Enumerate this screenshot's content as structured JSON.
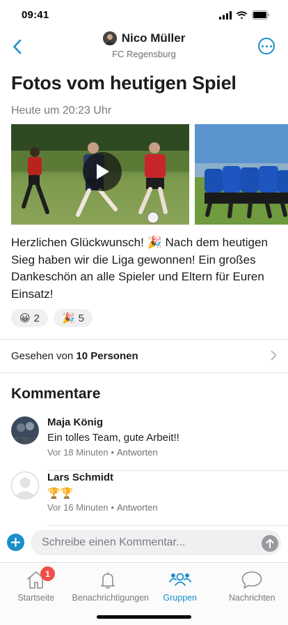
{
  "status_bar": {
    "time": "09:41"
  },
  "header": {
    "name": "Nico Müller",
    "subtitle": "FC Regensburg"
  },
  "post": {
    "title": "Fotos vom heutigen Spiel",
    "timestamp": "Heute um 20:23 Uhr",
    "body": "Herzlichen Glückwunsch! 🎉 Nach dem heutigen Sieg haben wir die Liga gewonnen! Ein großes Dankeschön an alle Spieler und Eltern für Euren Einsatz!",
    "reactions": [
      {
        "emoji": "😀",
        "count": "2"
      },
      {
        "emoji": "🎉",
        "count": "5"
      }
    ]
  },
  "seen": {
    "prefix": "Gesehen von",
    "count": "10 Personen"
  },
  "comments": {
    "title": "Kommentare",
    "items": [
      {
        "name": "Maja König",
        "text": "Ein tolles Team, gute Arbeit!!",
        "time": "Vor 18 Minuten",
        "reply": "Antworten"
      },
      {
        "name": "Lars Schmidt",
        "text": "🏆🏆",
        "time": "Vor 16 Minuten",
        "reply": "Antworten"
      }
    ]
  },
  "composer": {
    "placeholder": "Schreibe einen Kommentar..."
  },
  "tabbar": {
    "items": [
      {
        "label": "Startseite",
        "icon": "home-icon",
        "badge": "1"
      },
      {
        "label": "Benachrichtigungen",
        "icon": "bell-icon"
      },
      {
        "label": "Gruppen",
        "icon": "groups-icon",
        "active": true
      },
      {
        "label": "Nachrichten",
        "icon": "chat-bubble-icon"
      }
    ]
  },
  "colors": {
    "accent": "#1a8fc9",
    "badge": "#f04e48"
  }
}
